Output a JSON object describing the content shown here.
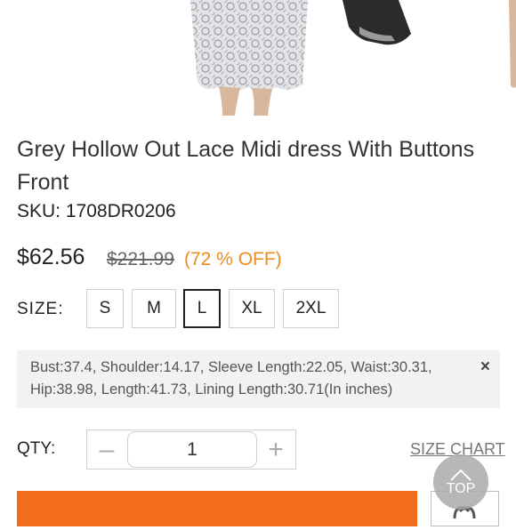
{
  "product": {
    "title": "Grey Hollow Out Lace Midi dress With Buttons Front",
    "sku_label": "SKU:",
    "sku_value": "1708DR0206",
    "price": "$62.56",
    "original_price": "$221.99",
    "discount": "(72 % OFF)"
  },
  "size": {
    "label": "SIZE:",
    "options": [
      "S",
      "M",
      "L",
      "XL",
      "2XL"
    ],
    "selected": "L",
    "info": "Bust:37.4, Shoulder:14.17, Sleeve Length:22.05, Waist:30.31, Hip:38.98, Length:41.73, Lining Length:30.71(In inches)",
    "close_symbol": "×"
  },
  "quantity": {
    "label": "QTY:",
    "value": "1",
    "minus_symbol": "–",
    "plus_symbol": "+"
  },
  "links": {
    "size_chart": "SIZE CHART",
    "top": "TOP"
  },
  "colors": {
    "accent": "#f26c1e",
    "discount": "#f08a1c"
  },
  "icons": [
    "close-icon",
    "minus-icon",
    "plus-icon",
    "chevron-up-icon",
    "heart-icon"
  ]
}
